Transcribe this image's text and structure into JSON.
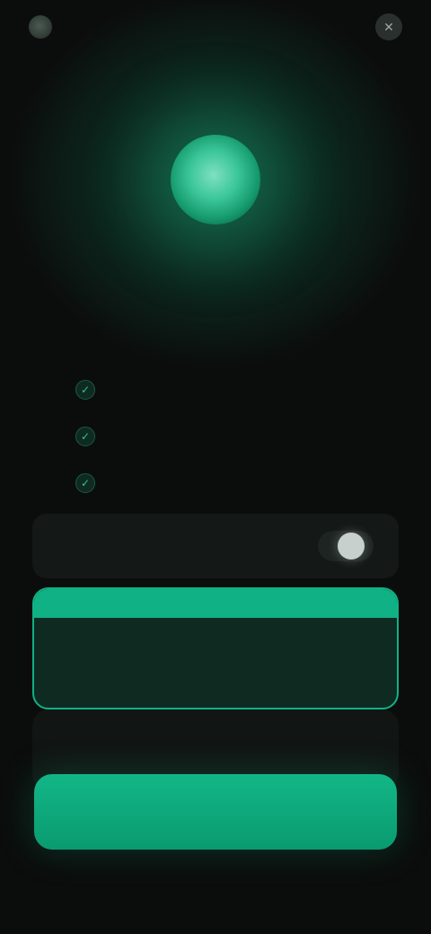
{
  "topbar": {
    "brand_name": "",
    "restore_link": "",
    "close_symbol": "✕"
  },
  "title": "",
  "features": [
    {
      "icon": "check-icon",
      "text": ""
    },
    {
      "icon": "check-icon",
      "text": ""
    },
    {
      "icon": "check-icon",
      "text": ""
    }
  ],
  "plans": {
    "toggle_label": "",
    "toggle_on": true,
    "featured": {
      "badge": "",
      "name": "",
      "subtitle": "",
      "price": ""
    },
    "secondary": {
      "name": "",
      "price": ""
    }
  },
  "cta_label": "",
  "footer": {
    "links": [
      "",
      "",
      ""
    ]
  },
  "colors": {
    "accent": "#10b184",
    "background": "#0b0d0c"
  }
}
